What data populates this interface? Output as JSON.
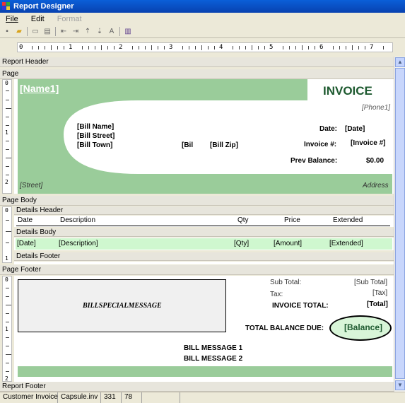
{
  "window": {
    "title": "Report Designer"
  },
  "menu": {
    "file": "File",
    "edit": "Edit",
    "format": "Format"
  },
  "ruler": {
    "marks": [
      "0",
      "1",
      "2",
      "3",
      "4",
      "5",
      "6",
      "7"
    ]
  },
  "bands": {
    "report_header": "Report Header",
    "page": "Page",
    "page_body": "Page Body",
    "details_header": "Details Header",
    "details_body": "Details Body",
    "details_footer": "Details Footer",
    "page_footer": "Page Footer",
    "report_footer": "Report Footer"
  },
  "header": {
    "name_field": "[Name1]",
    "invoice_title": "INVOICE",
    "phone_field": "[Phone1]",
    "bill_name": "[Bill Name]",
    "bill_street": "[Bill Street]",
    "bill_town": "[Bill Town]",
    "bill_state": "[Bil",
    "bill_zip": "[Bill Zip]",
    "date_label": "Date:",
    "date_field": "[Date]",
    "invoice_no_label": "Invoice #:",
    "invoice_no_field": "[Invoice #]",
    "prev_balance_label": "Prev Balance:",
    "prev_balance_value": "$0.00",
    "street_field": "[Street]",
    "address_label": "Address"
  },
  "details_header": {
    "columns": [
      "Date",
      "Description",
      "Qty",
      "Price",
      "Extended"
    ]
  },
  "details_body": {
    "fields": [
      "[Date]",
      "[Description]",
      "[Qty]",
      "[Amount]",
      "[Extended]"
    ]
  },
  "footer": {
    "special_message": "BILLSPECIALMESSAGE",
    "subtotal_label": "Sub Total:",
    "subtotal_field": "[Sub Total]",
    "tax_label": "Tax:",
    "tax_field": "[Tax]",
    "invoice_total_label": "INVOICE TOTAL:",
    "invoice_total_field": "[Total]",
    "balance_due_label": "TOTAL BALANCE DUE:",
    "balance_field": "[Balance]",
    "bill_message_1": "BILL MESSAGE 1",
    "bill_message_2": "BILL MESSAGE 2"
  },
  "status": {
    "report_name": "Customer Invoice",
    "file": "Capsule.inv",
    "x": "331",
    "y": "78"
  },
  "colors": {
    "accent_green": "#9acc9a",
    "dark_green": "#1e5a30",
    "detail_row": "#cff7cf",
    "balance_fill": "#d8f5d8"
  }
}
